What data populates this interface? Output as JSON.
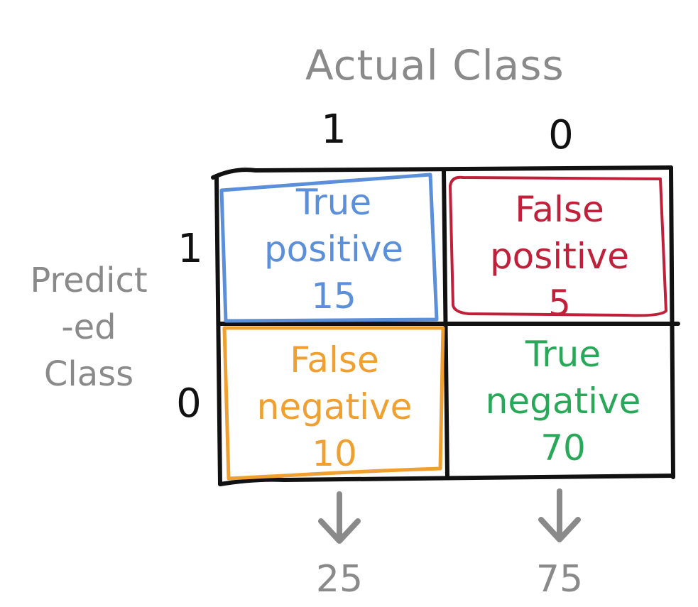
{
  "title": "Actual Class",
  "columns": [
    "1",
    "0"
  ],
  "rows": [
    "1",
    "0"
  ],
  "row_axis_label": [
    "Predict",
    "-ed",
    "Class"
  ],
  "cells": {
    "tp": {
      "line1": "True",
      "line2": "positive",
      "value": "15",
      "color": "#5b8fd9"
    },
    "fp": {
      "line1": "False",
      "line2": "positive",
      "value": "5",
      "color": "#c0203a"
    },
    "fn": {
      "line1": "False",
      "line2": "negative",
      "value": "10",
      "color": "#f0a030"
    },
    "tn": {
      "line1": "True",
      "line2": "negative",
      "value": "70",
      "color": "#2aa85a"
    }
  },
  "totals": [
    "25",
    "75"
  ],
  "colors": {
    "grid": "#111111",
    "muted": "#8a8a8a"
  },
  "icons": {
    "arrow": "arrow-down-icon"
  }
}
